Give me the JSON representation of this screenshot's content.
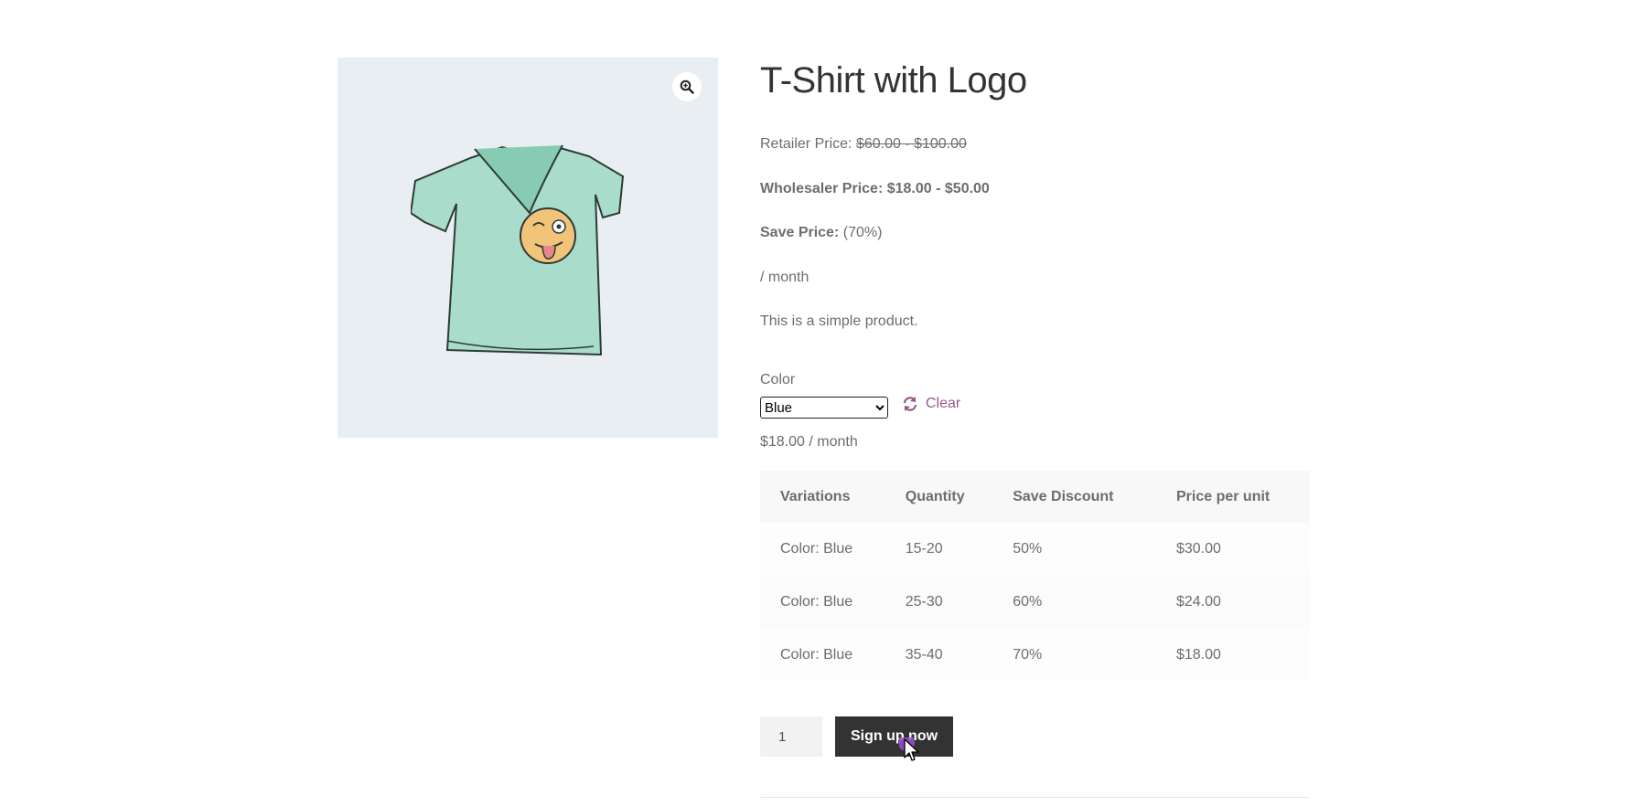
{
  "product": {
    "title": "T-Shirt with Logo",
    "retailer_label": "Retailer Price:",
    "retailer_price": "$60.00 - $100.00",
    "wholesaler_label": "Wholesaler Price:",
    "wholesaler_price": "$18.00 - $50.00",
    "save_label": "Save Price:",
    "save_value": "(70%)",
    "period": "/ month",
    "description": "This is a simple product.",
    "image_icon": "zoom-icon"
  },
  "variation": {
    "color_label": "Color",
    "selected_color": "Blue",
    "clear_label": "Clear",
    "price": "$18.00 / month"
  },
  "tiers": {
    "headers": [
      "Variations",
      "Quantity",
      "Save Discount",
      "Price per unit"
    ],
    "rows": [
      [
        "Color: Blue",
        "15-20",
        "50%",
        "$30.00"
      ],
      [
        "Color: Blue",
        "25-30",
        "60%",
        "$24.00"
      ],
      [
        "Color: Blue",
        "35-40",
        "70%",
        "$18.00"
      ]
    ]
  },
  "cart": {
    "quantity": "1",
    "button_label": "Sign up now"
  },
  "colors": {
    "accent": "#96588a",
    "button": "#333333",
    "cursor_highlight": "#9b4fd1"
  }
}
